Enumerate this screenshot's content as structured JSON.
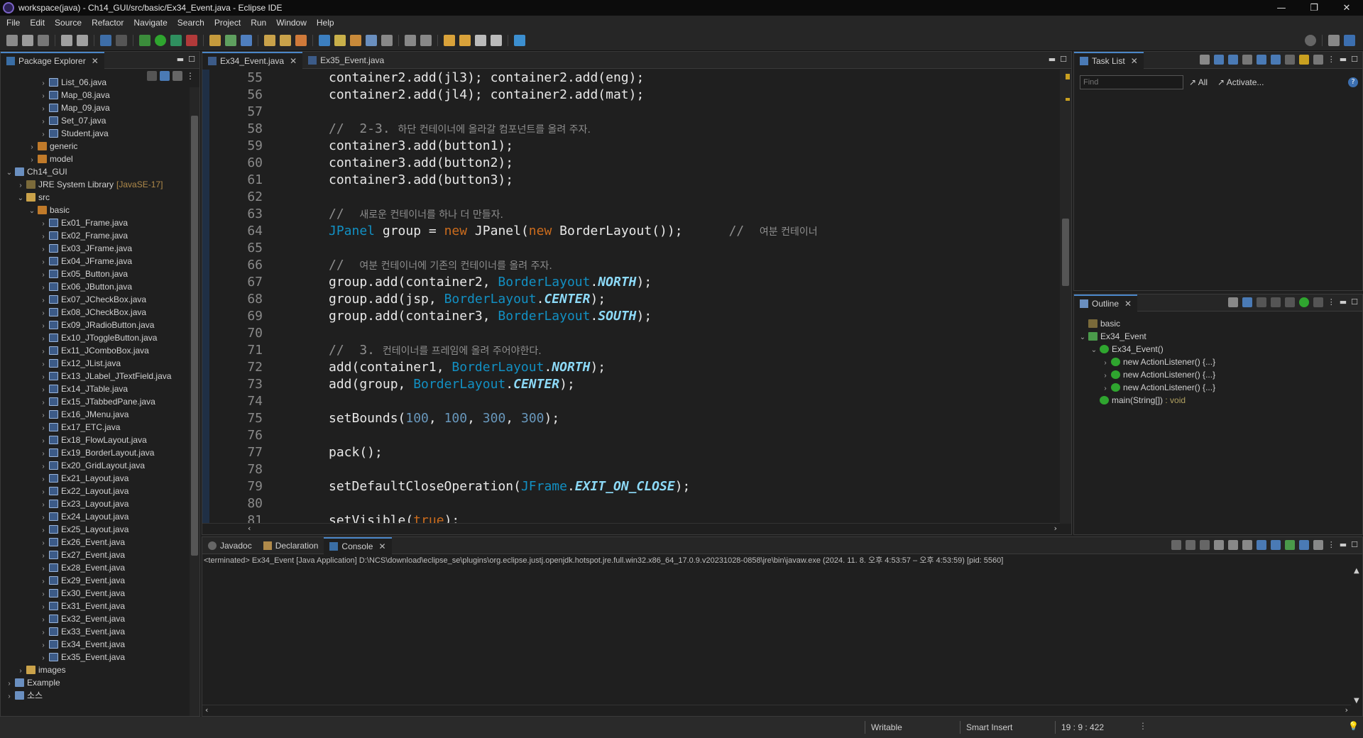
{
  "window": {
    "title": "workspace(java) - Ch14_GUI/src/basic/Ex34_Event.java - Eclipse IDE",
    "controls": [
      "—",
      "❐",
      "✕"
    ]
  },
  "menu": [
    "File",
    "Edit",
    "Source",
    "Refactor",
    "Navigate",
    "Search",
    "Project",
    "Run",
    "Window",
    "Help"
  ],
  "package_explorer": {
    "title": "Package Explorer",
    "items": [
      {
        "label": "List_06.java",
        "indent": 3,
        "icon": "java",
        "chevron": "›"
      },
      {
        "label": "Map_08.java",
        "indent": 3,
        "icon": "java",
        "chevron": "›"
      },
      {
        "label": "Map_09.java",
        "indent": 3,
        "icon": "java",
        "chevron": "›"
      },
      {
        "label": "Set_07.java",
        "indent": 3,
        "icon": "java",
        "chevron": "›"
      },
      {
        "label": "Student.java",
        "indent": 3,
        "icon": "java",
        "chevron": "›"
      },
      {
        "label": "generic",
        "indent": 2,
        "icon": "package",
        "chevron": "›"
      },
      {
        "label": "model",
        "indent": 2,
        "icon": "package",
        "chevron": "›"
      },
      {
        "label": "Ch14_GUI",
        "indent": 0,
        "icon": "project",
        "chevron": "⌄"
      },
      {
        "label": "JRE System Library",
        "suffix": "[JavaSE-17]",
        "indent": 1,
        "icon": "library",
        "chevron": "›"
      },
      {
        "label": "src",
        "indent": 1,
        "icon": "folder",
        "chevron": "⌄"
      },
      {
        "label": "basic",
        "indent": 2,
        "icon": "package",
        "chevron": "⌄"
      },
      {
        "label": "Ex01_Frame.java",
        "indent": 3,
        "icon": "java",
        "chevron": "›"
      },
      {
        "label": "Ex02_Frame.java",
        "indent": 3,
        "icon": "java",
        "chevron": "›"
      },
      {
        "label": "Ex03_JFrame.java",
        "indent": 3,
        "icon": "java",
        "chevron": "›"
      },
      {
        "label": "Ex04_JFrame.java",
        "indent": 3,
        "icon": "java",
        "chevron": "›"
      },
      {
        "label": "Ex05_Button.java",
        "indent": 3,
        "icon": "java",
        "chevron": "›"
      },
      {
        "label": "Ex06_JButton.java",
        "indent": 3,
        "icon": "java",
        "chevron": "›"
      },
      {
        "label": "Ex07_JCheckBox.java",
        "indent": 3,
        "icon": "java",
        "chevron": "›"
      },
      {
        "label": "Ex08_JCheckBox.java",
        "indent": 3,
        "icon": "java",
        "chevron": "›"
      },
      {
        "label": "Ex09_JRadioButton.java",
        "indent": 3,
        "icon": "java",
        "chevron": "›"
      },
      {
        "label": "Ex10_JToggleButton.java",
        "indent": 3,
        "icon": "java",
        "chevron": "›"
      },
      {
        "label": "Ex11_JComboBox.java",
        "indent": 3,
        "icon": "java",
        "chevron": "›"
      },
      {
        "label": "Ex12_JList.java",
        "indent": 3,
        "icon": "java",
        "chevron": "›"
      },
      {
        "label": "Ex13_JLabel_JTextField.java",
        "indent": 3,
        "icon": "java",
        "chevron": "›"
      },
      {
        "label": "Ex14_JTable.java",
        "indent": 3,
        "icon": "java",
        "chevron": "›"
      },
      {
        "label": "Ex15_JTabbedPane.java",
        "indent": 3,
        "icon": "java",
        "chevron": "›"
      },
      {
        "label": "Ex16_JMenu.java",
        "indent": 3,
        "icon": "java",
        "chevron": "›"
      },
      {
        "label": "Ex17_ETC.java",
        "indent": 3,
        "icon": "java",
        "chevron": "›"
      },
      {
        "label": "Ex18_FlowLayout.java",
        "indent": 3,
        "icon": "java",
        "chevron": "›"
      },
      {
        "label": "Ex19_BorderLayout.java",
        "indent": 3,
        "icon": "java",
        "chevron": "›"
      },
      {
        "label": "Ex20_GridLayout.java",
        "indent": 3,
        "icon": "java",
        "chevron": "›"
      },
      {
        "label": "Ex21_Layout.java",
        "indent": 3,
        "icon": "java",
        "chevron": "›"
      },
      {
        "label": "Ex22_Layout.java",
        "indent": 3,
        "icon": "java",
        "chevron": "›"
      },
      {
        "label": "Ex23_Layout.java",
        "indent": 3,
        "icon": "java",
        "chevron": "›"
      },
      {
        "label": "Ex24_Layout.java",
        "indent": 3,
        "icon": "java",
        "chevron": "›"
      },
      {
        "label": "Ex25_Layout.java",
        "indent": 3,
        "icon": "java",
        "chevron": "›"
      },
      {
        "label": "Ex26_Event.java",
        "indent": 3,
        "icon": "java",
        "chevron": "›"
      },
      {
        "label": "Ex27_Event.java",
        "indent": 3,
        "icon": "java",
        "chevron": "›"
      },
      {
        "label": "Ex28_Event.java",
        "indent": 3,
        "icon": "java",
        "chevron": "›"
      },
      {
        "label": "Ex29_Event.java",
        "indent": 3,
        "icon": "java",
        "chevron": "›"
      },
      {
        "label": "Ex30_Event.java",
        "indent": 3,
        "icon": "java",
        "chevron": "›"
      },
      {
        "label": "Ex31_Event.java",
        "indent": 3,
        "icon": "java",
        "chevron": "›"
      },
      {
        "label": "Ex32_Event.java",
        "indent": 3,
        "icon": "java",
        "chevron": "›"
      },
      {
        "label": "Ex33_Event.java",
        "indent": 3,
        "icon": "java",
        "chevron": "›"
      },
      {
        "label": "Ex34_Event.java",
        "indent": 3,
        "icon": "java",
        "chevron": "›"
      },
      {
        "label": "Ex35_Event.java",
        "indent": 3,
        "icon": "java",
        "chevron": "›"
      },
      {
        "label": "images",
        "indent": 1,
        "icon": "folder",
        "chevron": "›"
      },
      {
        "label": "Example",
        "indent": 0,
        "icon": "project",
        "chevron": "›"
      },
      {
        "label": "소스",
        "indent": 0,
        "icon": "project",
        "chevron": "›"
      }
    ]
  },
  "editor": {
    "tabs": [
      {
        "label": "Ex34_Event.java",
        "active": true
      },
      {
        "label": "Ex35_Event.java",
        "active": false
      }
    ],
    "lines": [
      {
        "n": "55",
        "tokens": [
          [
            "n",
            "container2.add(jl3); container2.add(eng);"
          ]
        ]
      },
      {
        "n": "56",
        "tokens": [
          [
            "n",
            "container2.add(jl4); container2.add(mat);"
          ]
        ]
      },
      {
        "n": "57",
        "tokens": []
      },
      {
        "n": "58",
        "tokens": [
          [
            "c",
            "//  2-3. "
          ],
          [
            "ck",
            "하단 컨테이너에 올라갈 컴포넌트를 올려 주자."
          ]
        ]
      },
      {
        "n": "59",
        "tokens": [
          [
            "n",
            "container3.add(button1);"
          ]
        ]
      },
      {
        "n": "60",
        "tokens": [
          [
            "n",
            "container3.add(button2);"
          ]
        ]
      },
      {
        "n": "61",
        "tokens": [
          [
            "n",
            "container3.add(button3);"
          ]
        ]
      },
      {
        "n": "62",
        "tokens": []
      },
      {
        "n": "63",
        "tokens": [
          [
            "c",
            "//  "
          ],
          [
            "ck",
            "새로운 컨테이너를 하나 더 만들자."
          ]
        ]
      },
      {
        "n": "64",
        "tokens": [
          [
            "t",
            "JPanel"
          ],
          [
            "n",
            " group = "
          ],
          [
            "k",
            "new"
          ],
          [
            "n",
            " JPanel("
          ],
          [
            "k",
            "new"
          ],
          [
            "n",
            " BorderLayout());      "
          ],
          [
            "c",
            "//  "
          ],
          [
            "ck",
            "여분 컨테이너"
          ]
        ]
      },
      {
        "n": "65",
        "tokens": []
      },
      {
        "n": "66",
        "tokens": [
          [
            "c",
            "//  "
          ],
          [
            "ck",
            "여분 컨테이너에 기존의 컨테이너를 올려 주자."
          ]
        ]
      },
      {
        "n": "67",
        "tokens": [
          [
            "n",
            "group.add(container2, "
          ],
          [
            "t",
            "BorderLayout"
          ],
          [
            "n",
            "."
          ],
          [
            "s",
            "NORTH"
          ],
          [
            "n",
            ");"
          ]
        ]
      },
      {
        "n": "68",
        "tokens": [
          [
            "n",
            "group.add(jsp, "
          ],
          [
            "t",
            "BorderLayout"
          ],
          [
            "n",
            "."
          ],
          [
            "s",
            "CENTER"
          ],
          [
            "n",
            ");"
          ]
        ]
      },
      {
        "n": "69",
        "tokens": [
          [
            "n",
            "group.add(container3, "
          ],
          [
            "t",
            "BorderLayout"
          ],
          [
            "n",
            "."
          ],
          [
            "s",
            "SOUTH"
          ],
          [
            "n",
            ");"
          ]
        ]
      },
      {
        "n": "70",
        "tokens": []
      },
      {
        "n": "71",
        "tokens": [
          [
            "c",
            "//  3. "
          ],
          [
            "ck",
            "컨테이너를 프레임에 올려 주어야한다."
          ]
        ]
      },
      {
        "n": "72",
        "tokens": [
          [
            "n",
            "add(container1, "
          ],
          [
            "t",
            "BorderLayout"
          ],
          [
            "n",
            "."
          ],
          [
            "s",
            "NORTH"
          ],
          [
            "n",
            ");"
          ]
        ]
      },
      {
        "n": "73",
        "tokens": [
          [
            "n",
            "add(group, "
          ],
          [
            "t",
            "BorderLayout"
          ],
          [
            "n",
            "."
          ],
          [
            "s",
            "CENTER"
          ],
          [
            "n",
            ");"
          ]
        ]
      },
      {
        "n": "74",
        "tokens": []
      },
      {
        "n": "75",
        "tokens": [
          [
            "n",
            "setBounds("
          ],
          [
            "d",
            "100"
          ],
          [
            "n",
            ", "
          ],
          [
            "d",
            "100"
          ],
          [
            "n",
            ", "
          ],
          [
            "d",
            "300"
          ],
          [
            "n",
            ", "
          ],
          [
            "d",
            "300"
          ],
          [
            "n",
            ");"
          ]
        ]
      },
      {
        "n": "76",
        "tokens": []
      },
      {
        "n": "77",
        "tokens": [
          [
            "n",
            "pack();"
          ]
        ]
      },
      {
        "n": "78",
        "tokens": []
      },
      {
        "n": "79",
        "tokens": [
          [
            "n",
            "setDefaultCloseOperation("
          ],
          [
            "t",
            "JFrame"
          ],
          [
            "n",
            "."
          ],
          [
            "s",
            "EXIT_ON_CLOSE"
          ],
          [
            "n",
            ");"
          ]
        ]
      },
      {
        "n": "80",
        "tokens": []
      },
      {
        "n": "81",
        "tokens": [
          [
            "n",
            "setVisible("
          ],
          [
            "k",
            "true"
          ],
          [
            "n",
            ");"
          ]
        ]
      }
    ]
  },
  "task_list": {
    "title": "Task List",
    "find_placeholder": "Find",
    "all_label": "All",
    "activate_label": "Activate..."
  },
  "outline": {
    "title": "Outline",
    "items": [
      {
        "label": "basic",
        "indent": 0,
        "chevron": ""
      },
      {
        "label": "Ex34_Event",
        "indent": 0,
        "chevron": "⌄"
      },
      {
        "label": "Ex34_Event()",
        "indent": 1,
        "chevron": "⌄"
      },
      {
        "label": "new ActionListener() {...}",
        "indent": 2,
        "chevron": "›"
      },
      {
        "label": "new ActionListener() {...}",
        "indent": 2,
        "chevron": "›"
      },
      {
        "label": "new ActionListener() {...}",
        "indent": 2,
        "chevron": "›"
      },
      {
        "label": "main(String[])",
        "suffix": " : void",
        "indent": 1,
        "chevron": ""
      }
    ]
  },
  "bottom": {
    "tabs": [
      {
        "label": "Javadoc",
        "active": false
      },
      {
        "label": "Declaration",
        "active": false
      },
      {
        "label": "Console",
        "active": true
      }
    ],
    "console_info": "<terminated> Ex34_Event [Java Application] D:\\NCS\\download\\eclipse_se\\plugins\\org.eclipse.justj.openjdk.hotspot.jre.full.win32.x86_64_17.0.9.v20231028-0858\\jre\\bin\\javaw.exe  (2024. 11. 8. 오후 4:53:57 – 오후 4:53:59) [pid: 5560]"
  },
  "status": {
    "writable": "Writable",
    "insert_mode": "Smart Insert",
    "position": "19 : 9 : 422"
  },
  "colors": {
    "keyword": "#cc6c1d",
    "type": "#1290c3",
    "constant": "#8ddaf8",
    "comment": "#8e8e8e",
    "number": "#6897bb",
    "accent": "#4a86c8"
  }
}
